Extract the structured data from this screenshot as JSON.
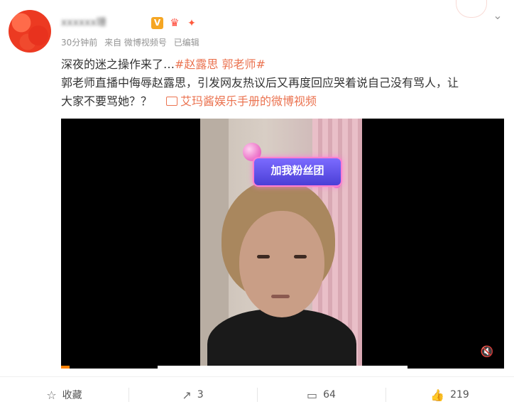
{
  "post": {
    "author_name": "xxxxxx珊",
    "meta": {
      "time": "30分钟前",
      "source": "来自 微博视频号",
      "edited": "已编辑"
    },
    "text_line1_prefix": "深夜的迷之操作来了…",
    "hashtags": [
      "#赵露思",
      "郭老师#"
    ],
    "text_line2": "郭老师直播中侮辱赵露思，引发网友热议后又再度回应哭着说自己没有骂人，让",
    "text_line3": "大家不要骂她？？",
    "video_link": "艾玛酱娱乐手册的微博视频"
  },
  "video": {
    "sticker_text": "加我粉丝团",
    "progress": 0.02
  },
  "actions": {
    "favorite": {
      "label": "收藏",
      "icon": "star-icon"
    },
    "repost": {
      "count": "3",
      "icon": "share-icon"
    },
    "comment": {
      "count": "64",
      "icon": "comment-icon"
    },
    "like": {
      "count": "219",
      "icon": "thumbs-up-icon"
    }
  },
  "colors": {
    "accent": "#eb7350",
    "progress": "#ff8200"
  }
}
